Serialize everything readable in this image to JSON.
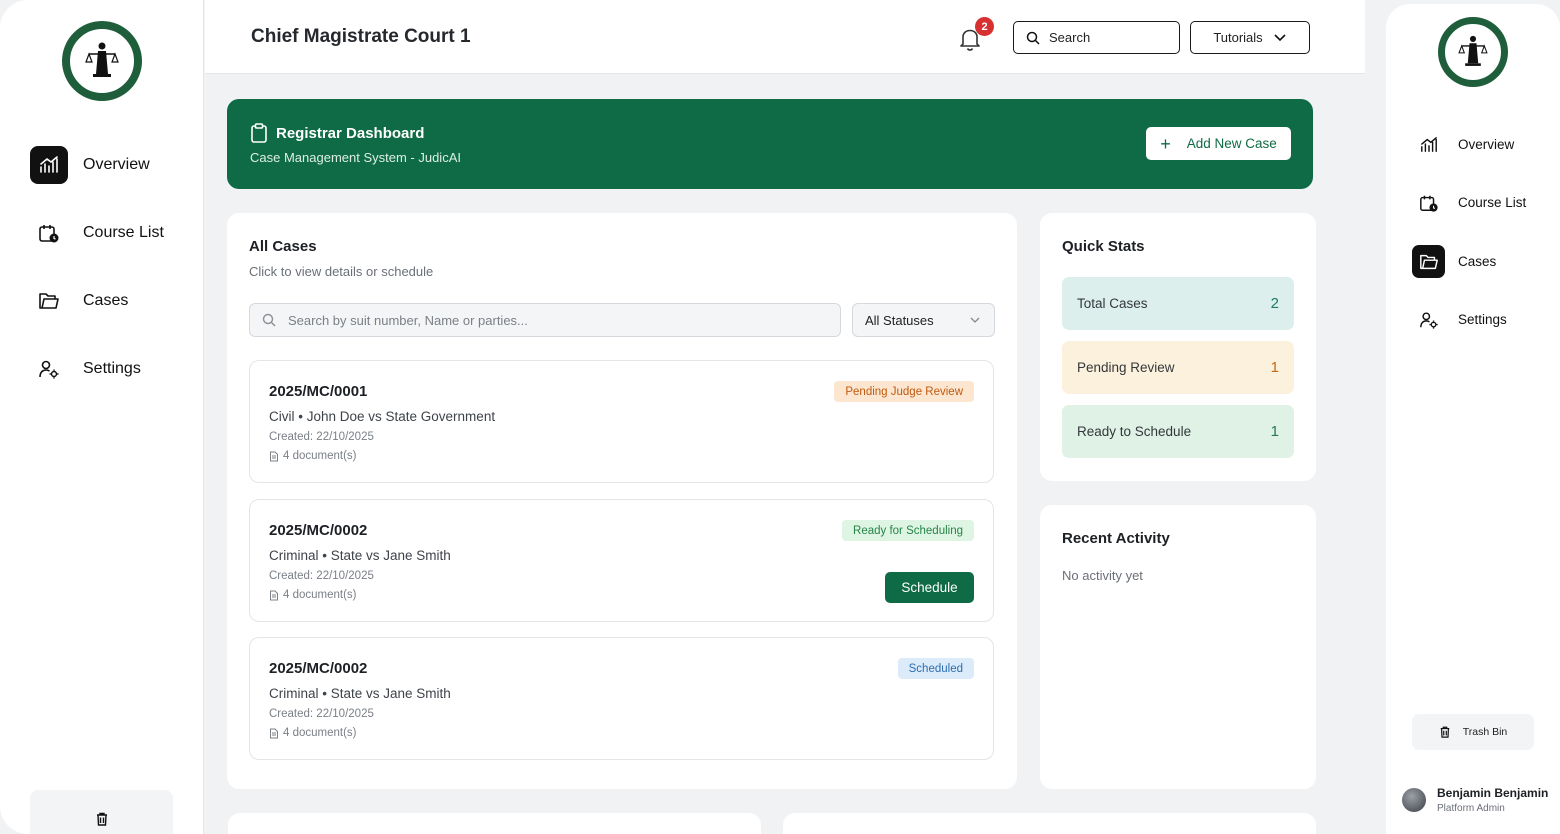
{
  "header": {
    "title": "Chief Magistrate Court 1",
    "notification_count": "2",
    "search_label": "Search",
    "tutorials_label": "Tutorials"
  },
  "left_nav": {
    "items": [
      {
        "label": "Overview",
        "icon": "chart-icon",
        "active": true
      },
      {
        "label": "Course List",
        "icon": "calendar-clock-icon",
        "active": false
      },
      {
        "label": "Cases",
        "icon": "folder-icon",
        "active": false
      },
      {
        "label": "Settings",
        "icon": "user-gear-icon",
        "active": false
      }
    ]
  },
  "banner": {
    "title": "Registrar Dashboard",
    "subtitle": "Case Management System - JudicAI",
    "add_case_label": "Add New Case"
  },
  "all_cases": {
    "title": "All Cases",
    "subtitle": "Click to view details or schedule",
    "search_placeholder": "Search by suit number, Name or parties...",
    "status_filter": "All Statuses",
    "cases": [
      {
        "number": "2025/MC/0001",
        "parties": "Civil • John Doe vs State Government",
        "created": "Created: 22/10/2025",
        "documents": "4 document(s)",
        "status": "Pending Judge Review"
      },
      {
        "number": "2025/MC/0002",
        "parties": "Criminal • State vs Jane Smith",
        "created": "Created: 22/10/2025",
        "documents": "4 document(s)",
        "status": "Ready for Scheduling",
        "action": "Schedule"
      },
      {
        "number": "2025/MC/0002",
        "parties": "Criminal • State vs Jane Smith",
        "created": "Created: 22/10/2025",
        "documents": "4 document(s)",
        "status": "Scheduled"
      }
    ]
  },
  "quick_stats": {
    "title": "Quick Stats",
    "items": [
      {
        "label": "Total Cases",
        "value": "2"
      },
      {
        "label": "Pending Review",
        "value": "1"
      },
      {
        "label": "Ready to Schedule",
        "value": "1"
      }
    ]
  },
  "recent_activity": {
    "title": "Recent Activity",
    "empty_text": "No activity yet"
  },
  "right_nav": {
    "items": [
      {
        "label": "Overview",
        "icon": "chart-icon",
        "active": false
      },
      {
        "label": "Course List",
        "icon": "calendar-clock-icon",
        "active": false
      },
      {
        "label": "Cases",
        "icon": "folder-icon",
        "active": true
      },
      {
        "label": "Settings",
        "icon": "user-gear-icon",
        "active": false
      }
    ],
    "trash_label": "Trash Bin"
  },
  "user": {
    "name": "Benjamin Benjamin",
    "role": "Platform Admin"
  },
  "colors": {
    "brand_green": "#0f6b45",
    "notification_red": "#d63030"
  }
}
